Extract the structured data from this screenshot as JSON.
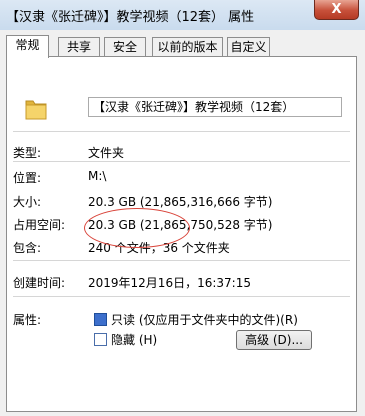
{
  "window": {
    "title": "【汉隶《张迁碑》】教学视频（12套） 属性",
    "close_glyph": "X"
  },
  "tabs": [
    "常规",
    "共享",
    "安全",
    "以前的版本",
    "自定义"
  ],
  "folder": {
    "icon": "folder-icon",
    "name": "【汉隶《张迁碑》】教学视频（12套）"
  },
  "properties": {
    "type_label": "类型:",
    "type_value": "文件夹",
    "location_label": "位置:",
    "location_value": "M:\\",
    "size_label": "大小:",
    "size_value": "20.3 GB (21,865,316,666 字节)",
    "disk_size_label": "占用空间:",
    "disk_size_value": "20.3 GB (21,865,750,528 字节)",
    "contains_label": "包含:",
    "contains_value": "240 个文件，36 个文件夹",
    "created_label": "创建时间:",
    "created_value": "2019年12月16日，16:37:15",
    "attributes_label": "属性:",
    "readonly_label": "只读 (仅应用于文件夹中的文件)(R)",
    "readonly_checked": "partial",
    "hidden_label": "隐藏 (H)",
    "hidden_checked": false,
    "advanced_label": "高级 (D)..."
  },
  "colors": {
    "annotation": "#d9443a",
    "folder": "#f2c94c"
  }
}
